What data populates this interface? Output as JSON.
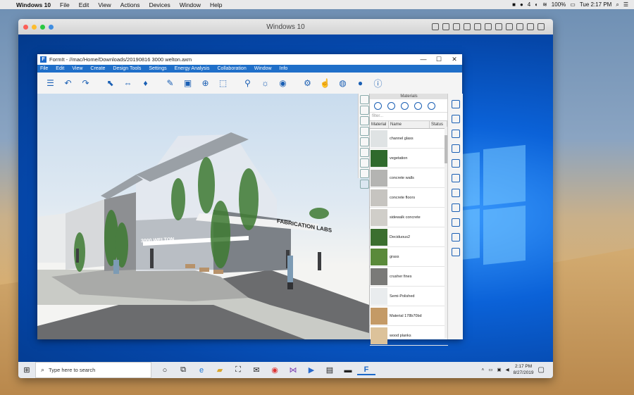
{
  "mac_menubar": {
    "app_name": "Windows 10",
    "menus": [
      "File",
      "Edit",
      "View",
      "Actions",
      "Devices",
      "Window",
      "Help"
    ],
    "status_items": [
      "4",
      "100%"
    ],
    "clock": "Tue 2:17 PM"
  },
  "vm_window": {
    "title": "Windows 10"
  },
  "formit": {
    "logo_letter": "F",
    "title": "FormIt - //mac/Home/Downloads/20190816 3000 welton.axm",
    "window_controls": [
      "—",
      "☐",
      "✕"
    ],
    "menu": [
      "File",
      "Edit",
      "View",
      "Create",
      "Design Tools",
      "Settings",
      "Energy Analysis",
      "Collaboration",
      "Window",
      "Info"
    ],
    "viewport_signs": [
      "FABRICATION LABS",
      "3000 WELTON"
    ],
    "materials_panel": {
      "title": "Materials",
      "search_placeholder": "filter...",
      "columns": [
        "Material",
        "Name",
        "Status"
      ],
      "items": [
        {
          "name": "channel glass",
          "swatch": "#dfe3e4"
        },
        {
          "name": "vegetation",
          "swatch": "#2f6a2c"
        },
        {
          "name": "concrete walls",
          "swatch": "#b4b4b2"
        },
        {
          "name": "concrete floors",
          "swatch": "#c6c4c0"
        },
        {
          "name": "sidewalk concrete",
          "swatch": "#d0cec9"
        },
        {
          "name": "Deciduous2",
          "swatch": "#3b6f2f"
        },
        {
          "name": "grass",
          "swatch": "#5a8a3a"
        },
        {
          "name": "crusher fines",
          "swatch": "#7a7a78"
        },
        {
          "name": "Semi-Polished",
          "swatch": "#e9ecee"
        },
        {
          "name": "Material 178b70bd",
          "swatch": "#c49a66"
        },
        {
          "name": "wood planks",
          "swatch": "#dcc29a"
        }
      ]
    }
  },
  "taskbar": {
    "search_placeholder": "Type here to search",
    "time": "2:17 PM",
    "date": "8/27/2019"
  },
  "colors": {
    "formit_blue": "#1f6fc9",
    "desktop_blue": "#0b62d8"
  }
}
